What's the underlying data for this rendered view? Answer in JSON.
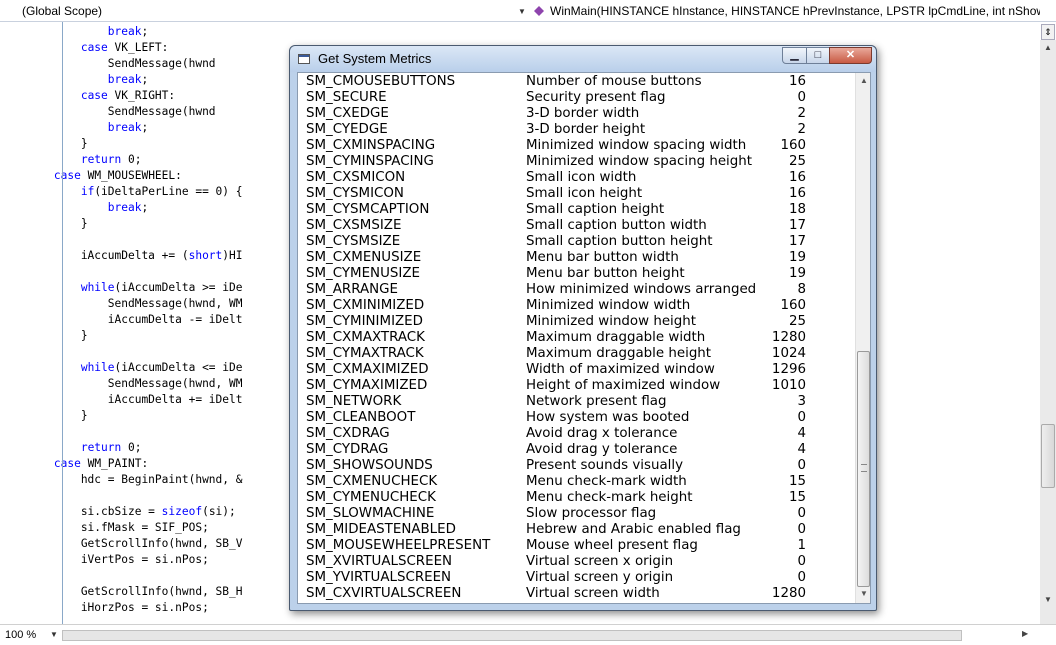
{
  "navbar": {
    "scope": "(Global Scope)",
    "function": "WinMain(HINSTANCE hInstance, HINSTANCE hPrevInstance, LPSTR lpCmdLine, int nShowCr"
  },
  "code_lines": [
    "                break;",
    "            case VK_LEFT:",
    "                SendMessage(hwnd",
    "                break;",
    "            case VK_RIGHT:",
    "                SendMessage(hwnd",
    "                break;",
    "            }",
    "            return 0;",
    "        case WM_MOUSEWHEEL:",
    "            if(iDeltaPerLine == 0) {",
    "                break;",
    "            }",
    "",
    "            iAccumDelta += (short)HI",
    "",
    "            while(iAccumDelta >= iDe",
    "                SendMessage(hwnd, WM",
    "                iAccumDelta -= iDelt",
    "            }",
    "",
    "            while(iAccumDelta <= iDe",
    "                SendMessage(hwnd, WM",
    "                iAccumDelta += iDelt",
    "            }",
    "",
    "            return 0;",
    "        case WM_PAINT:",
    "            hdc = BeginPaint(hwnd, &",
    "",
    "            si.cbSize = sizeof(si);",
    "            si.fMask = SIF_POS;",
    "            GetScrollInfo(hwnd, SB_V",
    "            iVertPos = si.nPos;",
    "",
    "            GetScrollInfo(hwnd, SB_H",
    "            iHorzPos = si.nPos;",
    ""
  ],
  "dialog": {
    "title": "Get System Metrics",
    "min_glyph": "▁",
    "max_glyph": "□",
    "close_glyph": "✕",
    "rows": [
      [
        "SM_CMOUSEBUTTONS",
        "Number of mouse buttons",
        "16"
      ],
      [
        "SM_SECURE",
        "Security present flag",
        "0"
      ],
      [
        "SM_CXEDGE",
        "3-D border width",
        "2"
      ],
      [
        "SM_CYEDGE",
        "3-D border height",
        "2"
      ],
      [
        "SM_CXMINSPACING",
        "Minimized window spacing width",
        "160"
      ],
      [
        "SM_CYMINSPACING",
        "Minimized window spacing height",
        "25"
      ],
      [
        "SM_CXSMICON",
        "Small icon width",
        "16"
      ],
      [
        "SM_CYSMICON",
        "Small icon height",
        "16"
      ],
      [
        "SM_CYSMCAPTION",
        "Small caption height",
        "18"
      ],
      [
        "SM_CXSMSIZE",
        "Small caption button width",
        "17"
      ],
      [
        "SM_CYSMSIZE",
        "Small caption button height",
        "17"
      ],
      [
        "SM_CXMENUSIZE",
        "Menu bar button width",
        "19"
      ],
      [
        "SM_CYMENUSIZE",
        "Menu bar button height",
        "19"
      ],
      [
        "SM_ARRANGE",
        "How minimized windows arranged",
        "8"
      ],
      [
        "SM_CXMINIMIZED",
        "Minimized window width",
        "160"
      ],
      [
        "SM_CYMINIMIZED",
        "Minimized window height",
        "25"
      ],
      [
        "SM_CXMAXTRACK",
        "Maximum draggable width",
        "1280"
      ],
      [
        "SM_CYMAXTRACK",
        "Maximum draggable height",
        "1024"
      ],
      [
        "SM_CXMAXIMIZED",
        "Width of maximized window",
        "1296"
      ],
      [
        "SM_CYMAXIMIZED",
        "Height of maximized window",
        "1010"
      ],
      [
        "SM_NETWORK",
        "Network present flag",
        "3"
      ],
      [
        "SM_CLEANBOOT",
        "How system was booted",
        "0"
      ],
      [
        "SM_CXDRAG",
        "Avoid drag x tolerance",
        "4"
      ],
      [
        "SM_CYDRAG",
        "Avoid drag y tolerance",
        "4"
      ],
      [
        "SM_SHOWSOUNDS",
        "Present sounds visually",
        "0"
      ],
      [
        "SM_CXMENUCHECK",
        "Menu check-mark width",
        "15"
      ],
      [
        "SM_CYMENUCHECK",
        "Menu check-mark height",
        "15"
      ],
      [
        "SM_SLOWMACHINE",
        "Slow processor flag",
        "0"
      ],
      [
        "SM_MIDEASTENABLED",
        "Hebrew and Arabic enabled flag",
        "0"
      ],
      [
        "SM_MOUSEWHEELPRESENT",
        "Mouse wheel present flag",
        "1"
      ],
      [
        "SM_XVIRTUALSCREEN",
        "Virtual screen x origin",
        "0"
      ],
      [
        "SM_YVIRTUALSCREEN",
        "Virtual screen y origin",
        "0"
      ],
      [
        "SM_CXVIRTUALSCREEN",
        "Virtual screen width",
        "1280"
      ]
    ]
  },
  "status": {
    "zoom": "100 %"
  },
  "icons": {
    "dropdown": "chevron-down-icon",
    "function": "method-icon"
  },
  "colors": {
    "keyword": "#0000ff",
    "title_bar": "#b9cfea",
    "close_button": "#c85a43"
  }
}
